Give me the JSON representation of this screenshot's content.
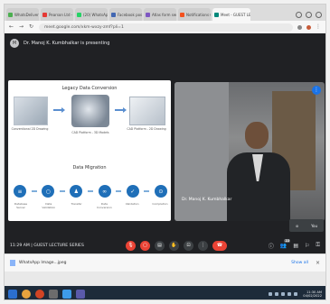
{
  "browser": {
    "tabs": [
      {
        "label": "WhatsDelivery.co",
        "color": "#4caf50"
      },
      {
        "label": "Pearson Ltd - Jh",
        "color": "#e53935"
      },
      {
        "label": "(20) WhatsApp",
        "color": "#25d366"
      },
      {
        "label": "Facebook post",
        "color": "#4267b2"
      },
      {
        "label": "Atlas form services",
        "color": "#7e57c2"
      },
      {
        "label": "Notifications (22)",
        "color": "#f4511e"
      },
      {
        "label": "Meet - GUEST LE",
        "color": "#00897b",
        "active": true
      }
    ],
    "url": "meet.google.com/xkm-wxzy-zmf?pli=1",
    "back_icon": "arrow-left-icon",
    "forward_icon": "arrow-right-icon",
    "reload_icon": "reload-icon"
  },
  "meet": {
    "presenter_text": "Dr. Manoj K. Kumbhalkar is presenting",
    "participant_name": "Dr. Manoj K. Kumbhalkar",
    "meeting_info": "11:29 AM  |  GUEST LECTURE SERIES",
    "self_label": "You",
    "participants_count": "22",
    "controls": [
      {
        "name": "mic-off-button",
        "icon": "🎙",
        "red": true
      },
      {
        "name": "camera-off-button",
        "icon": "▢",
        "red": true
      },
      {
        "name": "captions-button",
        "icon": "▤"
      },
      {
        "name": "raise-hand-button",
        "icon": "✋"
      },
      {
        "name": "present-button",
        "icon": "⊡"
      },
      {
        "name": "more-options-button",
        "icon": "⋮"
      }
    ],
    "leave_icon": "☎"
  },
  "slide": {
    "legacy_title": "Legacy Data Conversion",
    "legacy_captions": [
      "Conventional 2D Drawing",
      "CAD Platform - 3D Models",
      "CAD Platform - 2D Drawing"
    ],
    "migration_title": "Data Migration",
    "migration_steps": [
      "Database Server",
      "Data Validation",
      "Transfer",
      "Data Conversion",
      "Validation",
      "Completion"
    ]
  },
  "download_shelf": {
    "file_name": "WhatsApp Image...jpeg",
    "show_all": "Show all",
    "close": "×"
  },
  "taskbar": {
    "time": "11:30 AM",
    "date": "04/02/2022"
  }
}
